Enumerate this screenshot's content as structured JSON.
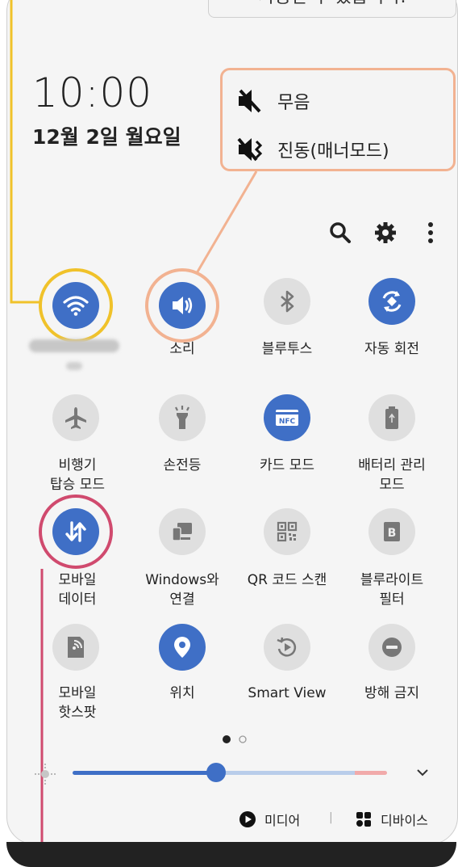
{
  "tooltip_text": "사용한 수 있습니다.",
  "status": {
    "time": "10:00",
    "date": "12월 2일 월요일"
  },
  "callout": {
    "mute_label": "무음",
    "vibrate_label": "진동(매너모드)"
  },
  "toolbar": {
    "search_icon": "search-icon",
    "settings_icon": "gear-icon",
    "more_icon": "more-vert-icon"
  },
  "tiles": [
    {
      "label": "",
      "state": "on",
      "icon": "wifi-icon"
    },
    {
      "label": "소리",
      "state": "on",
      "icon": "sound-icon"
    },
    {
      "label": "블루투스",
      "state": "off",
      "icon": "bluetooth-icon"
    },
    {
      "label": "자동 회전",
      "state": "on",
      "icon": "auto-rotate-icon"
    },
    {
      "label": "비행기\n탑승 모드",
      "state": "off",
      "icon": "airplane-icon"
    },
    {
      "label": "손전등",
      "state": "off",
      "icon": "flashlight-icon"
    },
    {
      "label": "카드 모드",
      "state": "on",
      "icon": "nfc-icon",
      "icon_text": "NFC"
    },
    {
      "label": "배터리 관리\n모드",
      "state": "off",
      "icon": "battery-icon"
    },
    {
      "label": "모바일\n데이터",
      "state": "on",
      "icon": "mobile-data-icon"
    },
    {
      "label": "Windows와\n연결",
      "state": "off",
      "icon": "windows-link-icon"
    },
    {
      "label": "QR 코드 스캔",
      "state": "off",
      "icon": "qr-icon"
    },
    {
      "label": "블루라이트\n필터",
      "state": "off",
      "icon": "blue-light-icon",
      "icon_text": "B"
    },
    {
      "label": "모바일\n핫스팟",
      "state": "off",
      "icon": "hotspot-icon"
    },
    {
      "label": "위치",
      "state": "on",
      "icon": "location-icon"
    },
    {
      "label": "Smart View",
      "state": "off",
      "icon": "smart-view-icon"
    },
    {
      "label": "방해 금지",
      "state": "off",
      "icon": "dnd-icon"
    }
  ],
  "pager": {
    "current": 1,
    "total": 2
  },
  "brightness": {
    "level": 0.35
  },
  "footer": {
    "media_label": "미디어",
    "separator": "|",
    "devices_label": "디바이스"
  },
  "colors": {
    "accent": "#3f6fc6",
    "tile_off": "#dfdfdf",
    "callout_border": "#f2b291",
    "wifi_ring": "#f0c22a",
    "data_ring": "#d04a6e"
  }
}
